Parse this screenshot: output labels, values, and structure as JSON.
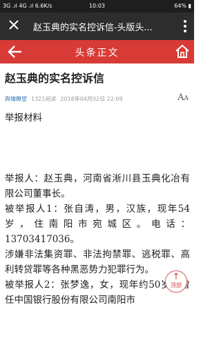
{
  "status_bar": {
    "left": "3G .ıl 4G .ıl 6.6K/s",
    "time": "10:03",
    "right": "64%"
  },
  "title_bar": {
    "title": "赵玉典的实名控诉信-头版头..."
  },
  "header": {
    "title": "头条正文"
  },
  "article": {
    "title": "赵玉典的实名控诉信",
    "source": "舆情瞭望",
    "reads": "1321阅读",
    "date": "2018年04月02日 22:09",
    "font_icon": "A",
    "paragraphs": [
      "举报材料",
      "",
      "举报人：赵玉典，河南省淅川县玉典化冶有限公司董事长。",
      "被举报人1：张自涛，男，汉族，现年54岁，住南阳市宛城区。电话：13703417036。",
      "涉嫌非法集资罪、非法拘禁罪、逃税罪、高利转贷罪等各种黑恶势力犯罪行为。",
      "被举报人2：张梦逸，女，现年约50岁，曾任中国银行股份有限公司南阳市"
    ]
  },
  "top_button": {
    "label": "顶部"
  },
  "colors": {
    "accent": "#d83a35",
    "title_bar": "#2d2d2d",
    "status_bar": "#1e1e1e",
    "source_link": "#3a79b9"
  }
}
